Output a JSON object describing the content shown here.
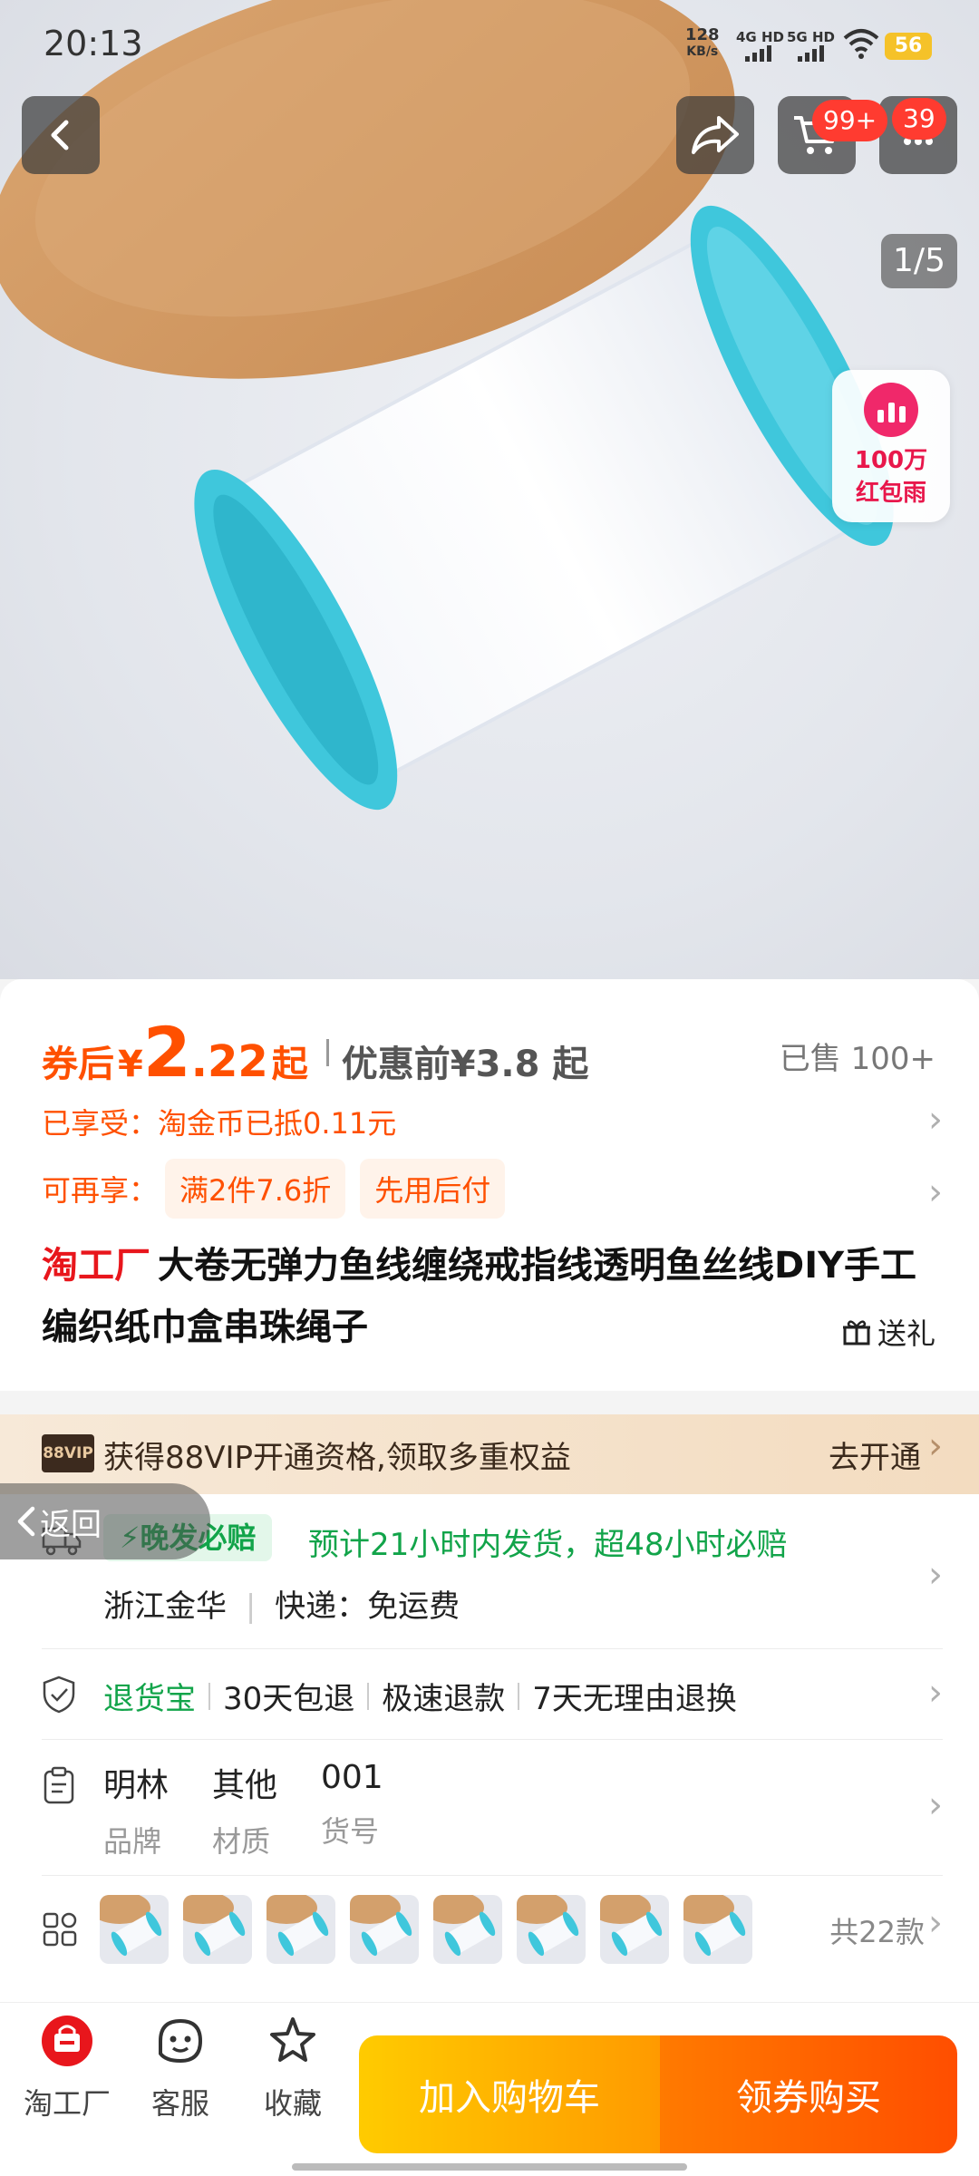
{
  "status_bar": {
    "time": "20:13",
    "net_speed_value": "128",
    "net_speed_unit": "KB/s",
    "sim1": "4G HD",
    "sim2": "5G HD",
    "battery": "56"
  },
  "top_nav": {
    "cart_badge": "99+",
    "msg_badge": "39",
    "page_indicator": "1/5"
  },
  "red_packet": {
    "line1": "100万",
    "line2": "红包雨"
  },
  "price": {
    "prefix": "券后",
    "currency": "¥",
    "integer": "2",
    "decimal": ".22",
    "suffix": "起",
    "original": "优惠前¥3.8 起",
    "sold": "已售 100+"
  },
  "benefits": {
    "enjoyed": "已享受：淘金币已抵0.11元",
    "more_label": "可再享：",
    "tags": [
      "满2件7.6折",
      "先用后付"
    ]
  },
  "product": {
    "brand": "淘工厂",
    "title": "大卷无弹力鱼线缠绕戒指线透明鱼丝线DIY手工编织纸巾盒串珠绳子",
    "gift_label": "送礼"
  },
  "vip": {
    "tag": "88VIP",
    "text": "获得88VIP开通资格,领取多重权益",
    "action": "去开通"
  },
  "back_label": "返回",
  "shipping": {
    "tag": "晚发必赔",
    "promise": "预计21小时内发货，超48小时必赔",
    "location": "浙江金华",
    "delivery": "快递：免运费"
  },
  "returns": {
    "badge": "退货宝",
    "items": [
      "30天包退",
      "极速退款",
      "7天无理由退换"
    ]
  },
  "attributes": [
    {
      "value": "明林",
      "label": "品牌"
    },
    {
      "value": "其他",
      "label": "材质"
    },
    {
      "value": "001",
      "label": "货号"
    }
  ],
  "variants": {
    "thumb_count_shown": 8,
    "total": "共22款"
  },
  "bottom_bar": {
    "tabs": [
      {
        "label": "淘工厂"
      },
      {
        "label": "客服"
      },
      {
        "label": "收藏"
      }
    ],
    "add_cart": "加入购物车",
    "buy": "领券购买"
  },
  "colors": {
    "accent": "#ff5000",
    "green": "#12a44a",
    "brand_red": "#e8161c",
    "spool_cyan": "#3fc7dc"
  }
}
